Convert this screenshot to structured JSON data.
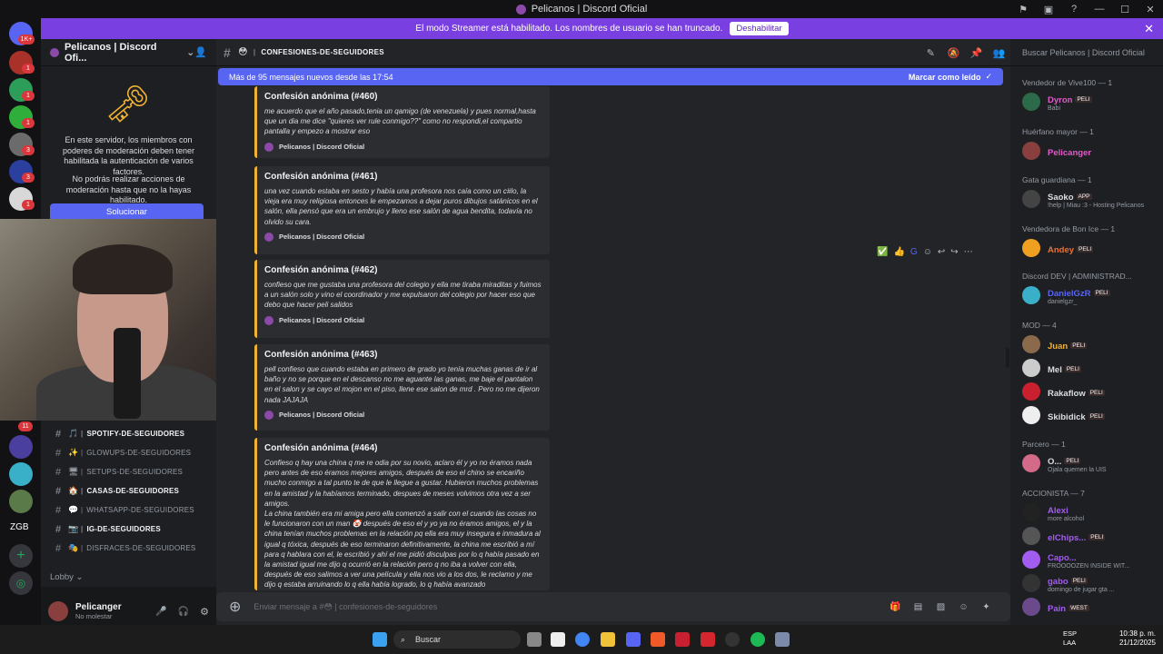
{
  "window": {
    "title": "Pelicanos | Discord Oficial"
  },
  "banner": {
    "text": "El modo Streamer está habilitado. Los nombres de usuario se han truncado.",
    "button": "Deshabilitar"
  },
  "guild_badges": [
    "1K+",
    "1",
    "1",
    "1",
    "3",
    "3",
    "1",
    "11"
  ],
  "guild_label": "ZGB",
  "server": {
    "name": "Pelicanos | Discord Ofi...",
    "notice1": "En este servidor, los miembros con poderes de moderación deben tener habilitada la autenticación de varios factores.",
    "notice2": "No podrás realizar acciones de moderación hasta que no la hayas habilitado.",
    "fix_button": "Solucionar"
  },
  "channels": [
    {
      "emoji": "🎵",
      "name": "spotify-de-seguidores",
      "bold": true
    },
    {
      "emoji": "✨",
      "name": "glowups-de-seguidores",
      "bold": false
    },
    {
      "emoji": "🖥",
      "name": "setups-de-seguidores",
      "bold": false
    },
    {
      "emoji": "🏠",
      "name": "casas-de-seguidores",
      "bold": true
    },
    {
      "emoji": "💬",
      "name": "whatsapp-de-seguidores",
      "bold": false
    },
    {
      "emoji": "📷",
      "name": "ig-de-seguidores",
      "bold": true
    },
    {
      "emoji": "🎭",
      "name": "disfraces-de-seguidores",
      "bold": false
    }
  ],
  "lobby": "Lobby",
  "user": {
    "name": "Pelicanger",
    "status": "No molestar"
  },
  "channel_header": {
    "name": "confesiones-de-seguidores"
  },
  "new_messages": {
    "text": "Más de 95 mensajes nuevos desde las 17:54",
    "mark_read": "Marcar como leído"
  },
  "embeds": [
    {
      "title": "Confesión anónima (#460)",
      "body": "me acuerdo que el año pasado,tenia un qamigo (de venezuela) y pues normal,hasta que un dia me dice \"quieres ver rule conmigo??\" como no respondi,el compartio pantalla y empezo a mostrar eso",
      "footer": "Pelicanos | Discord Oficial"
    },
    {
      "title": "Confesión anónima (#461)",
      "body": "una vez cuando estaba en sesto y había una profesora nos caía como un c#lo, la vieja era muy religiosa entonces le empezamos a dejar puros dibujos satánicos en el salón, ella pensó que era un embrujo y lleno ese salón de agua bendita, todavía no olvido su cara.",
      "footer": "Pelicanos | Discord Oficial"
    },
    {
      "title": "Confesión anónima (#462)",
      "body": "confieso que me gustaba una profesora del colegio y ella me tiraba miraditas y fuimos a un salón solo y vino el coordinador y me expulsaron del colegio por hacer eso que debo que hacer peli salidos",
      "footer": "Pelicanos | Discord Oficial"
    },
    {
      "title": "Confesión anónima (#463)",
      "body": "pell confieso que cuando estaba en primero de grado yo tenía muchas ganas de ir al baño y no se porque en el descanso no me aguante las ganas, me baje el pantalon en el salon y se cayo el mojon en el piso, llene ese salon de mrd . Pero no me dijeron nada JAJAJA",
      "footer": "Pelicanos | Discord Oficial"
    },
    {
      "title": "Confesión anónima (#464)",
      "body": "Confieso q hay una china q me re odia por su novio, aclaro él y yo no éramos nada pero antes de eso éramos mejores amigos, después de eso el chino se encariño mucho conmigo a tal punto te de que le llegue a gustar. Hubieron muchos problemas en la amistad y la habíamos terminado, despues de meses volvimos otra vez a ser amigos.",
      "body2": "La china también era mi amiga pero ella comenzó a salir con el cuando las cosas no le funcionaron con un man 🤡 después de eso el y yo ya no éramos amigos, el y la china tenían muchos problemas en la relación pq ella era muy insegura e inmadura al igual q tóxica, después de eso terminaron definitivamente, la china me escribió a mí para q hablara con el, le escribió y ahí el me pidió disculpas por lo q había pasado en la amistad igual me dijo q ocurrió en la relación pero q no iba a volver con ella, después de eso salimos a ver una película y ella nos vio a los dos, le reclamo y me dijo q estaba arruinando lo q ella había logrado, lo q había avanzado"
    }
  ],
  "composer": {
    "placeholder": "Enviar mensaje a #😳 | confesiones-de-seguidores"
  },
  "members_search": "Buscar Pelicanos | Discord Oficial",
  "roles": [
    {
      "label": "Vendedor de Vive100 — 1"
    },
    {
      "label": "Huérfano mayor — 1"
    },
    {
      "label": "Gata guardiana — 1"
    },
    {
      "label": "Vendedora de Bon Ice — 1"
    },
    {
      "label": "Discord DEV | ADMINISTRAD..."
    },
    {
      "label": "MOD — 4"
    },
    {
      "label": "Parcero — 1"
    },
    {
      "label": "ACCIONISTA — 7"
    }
  ],
  "members": [
    {
      "name": "Dyron",
      "tag": "PELI",
      "sub": "Babi",
      "color": "#e05cc8"
    },
    {
      "name": "Pelicanger",
      "tag": "",
      "sub": "",
      "color": "#e05cc8"
    },
    {
      "name": "Saoko",
      "tag": "APP",
      "sub": "!help | Miau :3 - Hosting Pelicanos",
      "color": "#dbdee1"
    },
    {
      "name": "Andey",
      "tag": "PELI",
      "sub": "",
      "color": "#e8733a"
    },
    {
      "name": "DanielGzR",
      "tag": "PELI",
      "sub": "danielgzr_",
      "color": "#5865f2"
    },
    {
      "name": "Juan",
      "tag": "PELI",
      "sub": "",
      "color": "#f0b232"
    },
    {
      "name": "Mel",
      "tag": "PELI",
      "sub": "",
      "color": "#dbdee1"
    },
    {
      "name": "Rakaflow",
      "tag": "PELI",
      "sub": "",
      "color": "#dbdee1"
    },
    {
      "name": "Skibidick",
      "tag": "PELI",
      "sub": "",
      "color": "#dbdee1"
    },
    {
      "name": "O...",
      "tag": "PELI",
      "sub": "Ojala quemen la UIS",
      "color": "#dbdee1"
    },
    {
      "name": "Alexi",
      "tag": "",
      "sub": "more alcohol",
      "color": "#a35cf0"
    },
    {
      "name": "elChips...",
      "tag": "PELI",
      "sub": "",
      "color": "#a35cf0"
    },
    {
      "name": "Capo...",
      "tag": "",
      "sub": "FROOOOZEN INSIDE WIT...",
      "color": "#a35cf0"
    },
    {
      "name": "gabo",
      "tag": "PELI",
      "sub": "domingo de jugar gta ...",
      "color": "#a35cf0"
    },
    {
      "name": "Pain",
      "tag": "WEST",
      "sub": "",
      "color": "#a35cf0"
    }
  ],
  "taskbar": {
    "search": "Buscar",
    "lang1": "ESP",
    "lang2": "LAA",
    "time": "10:38 p. m.",
    "date": "21/12/2025"
  }
}
